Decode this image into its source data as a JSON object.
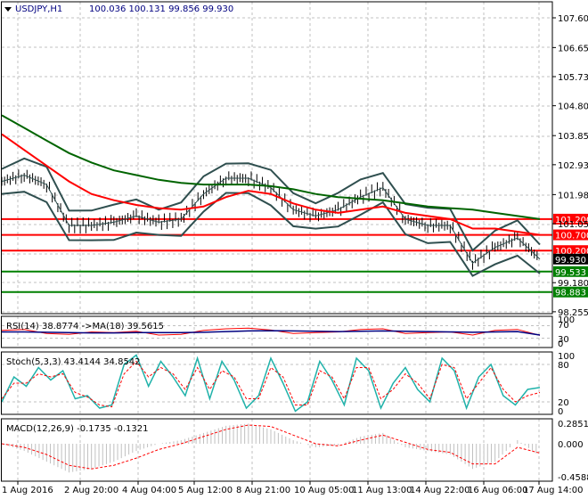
{
  "header": {
    "symbol": "USDJPY,H1",
    "ohlc": "100.036 100.131 99.856 99.930"
  },
  "colors": {
    "up": "#000000",
    "ma_long": "#006400",
    "ma_mid": "#ff0000",
    "bands": "#2f4f4f",
    "resistance": "#ff0000",
    "support": "#008000",
    "rsi": "#ff0000",
    "rsi_ma": "#000080",
    "stoch_main": "#20b2aa",
    "stoch_signal": "#ff0000",
    "macd_hist": "#c0c0c0",
    "macd_signal": "#ff0000"
  },
  "chart_data": [
    {
      "type": "line",
      "title": "USDJPY,H1",
      "ylim": [
        98.1,
        108.1
      ],
      "y_ticks": [
        "107.600",
        "106.655",
        "105.730",
        "104.805",
        "103.855",
        "102.930",
        "101.980",
        "101.055",
        "99.180",
        "98.255"
      ],
      "x_ticks": [
        "1 Aug 2016",
        "2 Aug 20:00",
        "4 Aug 04:00",
        "5 Aug 12:00",
        "8 Aug 21:00",
        "10 Aug 05:00",
        "11 Aug 13:00",
        "14 Aug 22:00",
        "16 Aug 06:00",
        "17 Aug 14:00"
      ],
      "series": [
        {
          "name": "price",
          "values": [
            102.4,
            102.6,
            102.3,
            101.0,
            101.0,
            101.1,
            101.3,
            101.1,
            101.2,
            102.0,
            102.5,
            102.5,
            102.2,
            101.5,
            101.3,
            101.5,
            101.9,
            102.2,
            101.2,
            101.0,
            101.0,
            99.8,
            100.3,
            100.6,
            99.93
          ]
        },
        {
          "name": "MA long",
          "values": [
            104.5,
            104.1,
            103.7,
            103.3,
            103.0,
            102.75,
            102.6,
            102.45,
            102.35,
            102.3,
            102.3,
            102.3,
            102.25,
            102.15,
            102.0,
            101.9,
            101.85,
            101.8,
            101.7,
            101.6,
            101.55,
            101.5,
            101.4,
            101.3,
            101.2
          ]
        },
        {
          "name": "MA mid",
          "values": [
            103.9,
            103.4,
            102.9,
            102.4,
            102.0,
            101.8,
            101.65,
            101.55,
            101.5,
            101.6,
            101.9,
            102.1,
            102.0,
            101.7,
            101.5,
            101.4,
            101.5,
            101.6,
            101.4,
            101.3,
            101.2,
            100.9,
            100.9,
            100.8,
            100.7
          ]
        }
      ],
      "levels": [
        {
          "label": "101.200",
          "value": 101.2,
          "kind": "resistance"
        },
        {
          "label": "100.700",
          "value": 100.7,
          "kind": "resistance"
        },
        {
          "label": "100.200",
          "value": 100.2,
          "kind": "resistance"
        },
        {
          "label": "99.930",
          "value": 99.93,
          "kind": "current"
        },
        {
          "label": "99.533",
          "value": 99.533,
          "kind": "support"
        },
        {
          "label": "98.883",
          "value": 98.883,
          "kind": "support"
        }
      ]
    },
    {
      "type": "line",
      "title": "RSI(14) 38.8774  ->MA(18) 39.5615",
      "ylim": [
        0,
        100
      ],
      "y_ticks": [
        "100",
        "70",
        "30",
        "0"
      ],
      "series": [
        {
          "name": "RSI",
          "values": [
            55,
            58,
            45,
            42,
            50,
            48,
            52,
            40,
            42,
            55,
            60,
            62,
            56,
            45,
            48,
            50,
            58,
            60,
            45,
            48,
            50,
            40,
            55,
            58,
            39
          ]
        },
        {
          "name": "MA",
          "values": [
            50,
            50,
            49,
            48,
            47,
            47,
            48,
            48,
            48,
            49,
            51,
            53,
            54,
            53,
            52,
            51,
            52,
            53,
            52,
            51,
            50,
            49,
            50,
            51,
            40
          ]
        }
      ]
    },
    {
      "type": "line",
      "title": "Stoch(5,3,3) 43.4144 34.8542",
      "ylim": [
        0,
        100
      ],
      "y_ticks": [
        "100",
        "80",
        "20",
        "0"
      ],
      "series": [
        {
          "name": "main",
          "values": [
            20,
            60,
            45,
            75,
            55,
            70,
            25,
            30,
            10,
            15,
            80,
            95,
            45,
            85,
            60,
            30,
            90,
            25,
            85,
            55,
            10,
            30,
            90,
            50,
            5,
            20,
            85,
            55,
            15,
            90,
            70,
            10,
            50,
            75,
            40,
            20,
            90,
            70,
            10,
            60,
            80,
            30,
            15,
            40,
            43
          ]
        },
        {
          "name": "signal",
          "values": [
            25,
            50,
            50,
            65,
            60,
            65,
            35,
            28,
            15,
            12,
            65,
            85,
            60,
            75,
            65,
            40,
            75,
            40,
            70,
            60,
            25,
            25,
            75,
            60,
            15,
            15,
            70,
            60,
            25,
            75,
            75,
            25,
            40,
            65,
            50,
            25,
            80,
            75,
            25,
            50,
            75,
            40,
            20,
            30,
            35
          ]
        }
      ]
    },
    {
      "type": "bar",
      "title": "MACD(12,26,9) -0.1735 -0.1321",
      "ylim": [
        -0.4588,
        0.2851
      ],
      "y_ticks": [
        "0.2851",
        "0.000",
        "-0.4588"
      ],
      "series": [
        {
          "name": "hist",
          "values": [
            0.0,
            -0.1,
            -0.25,
            -0.4,
            -0.35,
            -0.25,
            -0.1,
            0.0,
            0.05,
            0.15,
            0.25,
            0.28,
            0.2,
            0.05,
            -0.05,
            -0.02,
            0.1,
            0.15,
            -0.05,
            -0.1,
            -0.15,
            -0.35,
            -0.25,
            0.05,
            -0.17
          ]
        },
        {
          "name": "signal",
          "values": [
            0.0,
            -0.05,
            -0.15,
            -0.3,
            -0.35,
            -0.3,
            -0.2,
            -0.08,
            0.0,
            0.1,
            0.2,
            0.26,
            0.24,
            0.12,
            0.0,
            -0.03,
            0.05,
            0.12,
            0.02,
            -0.08,
            -0.12,
            -0.28,
            -0.28,
            -0.05,
            -0.13
          ]
        }
      ]
    }
  ]
}
